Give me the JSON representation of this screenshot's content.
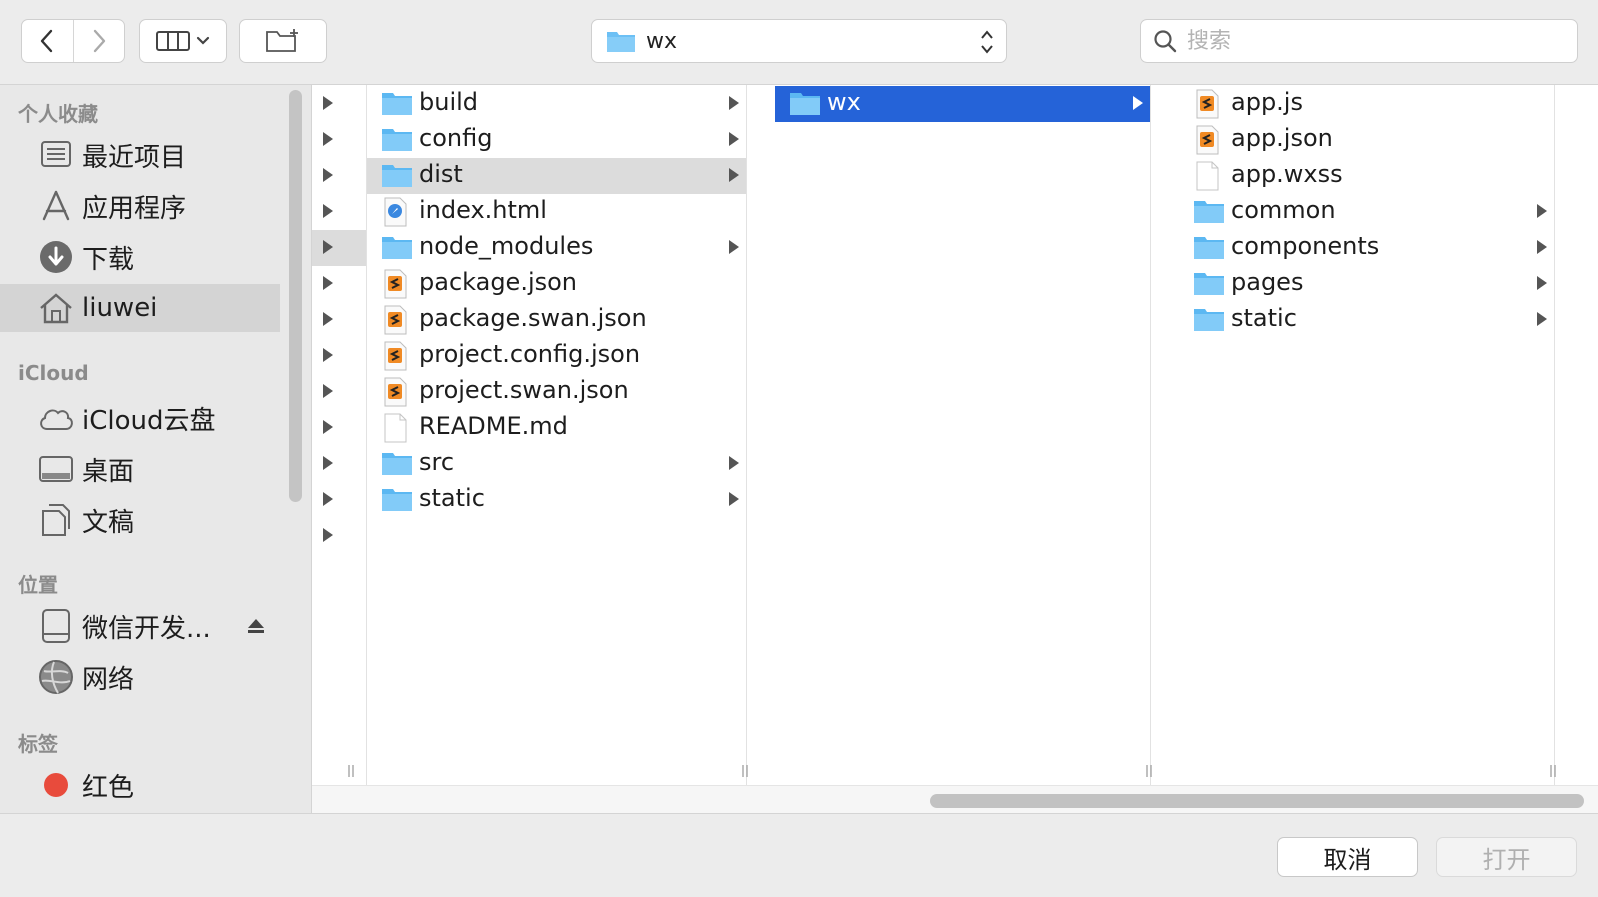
{
  "toolbar": {
    "path_label": "wx",
    "search_placeholder": "搜索"
  },
  "sidebar": {
    "sections": [
      {
        "header": "个人收藏",
        "items": [
          {
            "label": "最近项目",
            "icon": "recents-icon"
          },
          {
            "label": "应用程序",
            "icon": "applications-icon"
          },
          {
            "label": "下载",
            "icon": "downloads-icon"
          },
          {
            "label": "liuwei",
            "icon": "home-icon",
            "selected": true
          }
        ]
      },
      {
        "header": "iCloud",
        "items": [
          {
            "label": "iCloud云盘",
            "icon": "cloud-icon"
          },
          {
            "label": "桌面",
            "icon": "desktop-icon"
          },
          {
            "label": "文稿",
            "icon": "documents-icon"
          }
        ]
      },
      {
        "header": "位置",
        "items": [
          {
            "label": "微信开发...",
            "icon": "drive-icon",
            "eject": true
          },
          {
            "label": "网络",
            "icon": "network-icon"
          }
        ]
      },
      {
        "header": "标签",
        "items": [
          {
            "label": "红色",
            "icon": "red-tag-icon",
            "color": "#e84b3c"
          }
        ]
      }
    ]
  },
  "columns": {
    "col1_arrow_count": 13,
    "col2": [
      {
        "name": "build",
        "kind": "folder"
      },
      {
        "name": "config",
        "kind": "folder"
      },
      {
        "name": "dist",
        "kind": "folder",
        "selected": "gray"
      },
      {
        "name": "index.html",
        "kind": "html"
      },
      {
        "name": "node_modules",
        "kind": "folder"
      },
      {
        "name": "package.json",
        "kind": "json"
      },
      {
        "name": "package.swan.json",
        "kind": "json"
      },
      {
        "name": "project.config.json",
        "kind": "json"
      },
      {
        "name": "project.swan.json",
        "kind": "json"
      },
      {
        "name": "README.md",
        "kind": "file"
      },
      {
        "name": "src",
        "kind": "folder"
      },
      {
        "name": "static",
        "kind": "folder"
      }
    ],
    "col3": [
      {
        "name": "wx",
        "kind": "folder",
        "selected": "blue"
      }
    ],
    "col4": [
      {
        "name": "app.js",
        "kind": "json"
      },
      {
        "name": "app.json",
        "kind": "json"
      },
      {
        "name": "app.wxss",
        "kind": "file"
      },
      {
        "name": "common",
        "kind": "folder"
      },
      {
        "name": "components",
        "kind": "folder"
      },
      {
        "name": "pages",
        "kind": "folder"
      },
      {
        "name": "static",
        "kind": "folder"
      }
    ]
  },
  "buttons": {
    "cancel": "取消",
    "open": "打开"
  },
  "colors": {
    "selection_blue": "#2563d8",
    "folder_blue": "#6cc0f5"
  }
}
